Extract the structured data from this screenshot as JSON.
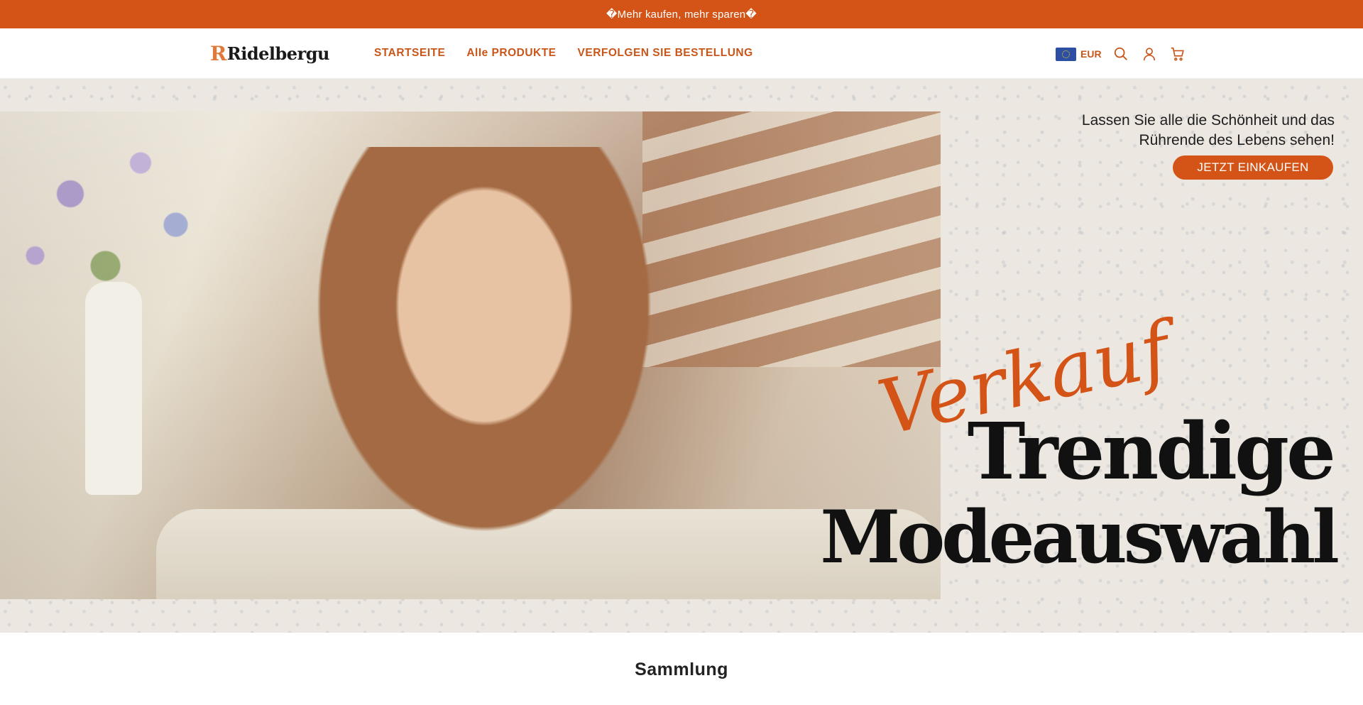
{
  "announcement": {
    "text": "�Mehr kaufen, mehr sparen�"
  },
  "header": {
    "logo_mark": "R",
    "logo_text": "Ridelbergu",
    "nav": [
      {
        "label": "STARTSEITE"
      },
      {
        "label": "AlIe PRODUKTE"
      },
      {
        "label": "VERFOLGEN SIE BESTELLUNG"
      }
    ],
    "currency": {
      "code": "EUR",
      "flag_icon": "eu-flag-icon"
    },
    "icons": [
      "search-icon",
      "account-icon",
      "cart-icon"
    ],
    "accent_color": "#d35416"
  },
  "hero": {
    "tagline_line1": "Lassen Sie alle die Schönheit und das",
    "tagline_line2": "Rührende des Lebens sehen!",
    "cta_label": "JETZT EINKAUFEN",
    "script_word": "Verkauf",
    "headline_line1": "Trendige",
    "headline_line2": "Modeauswahl"
  },
  "collection": {
    "title": "Sammlung"
  }
}
